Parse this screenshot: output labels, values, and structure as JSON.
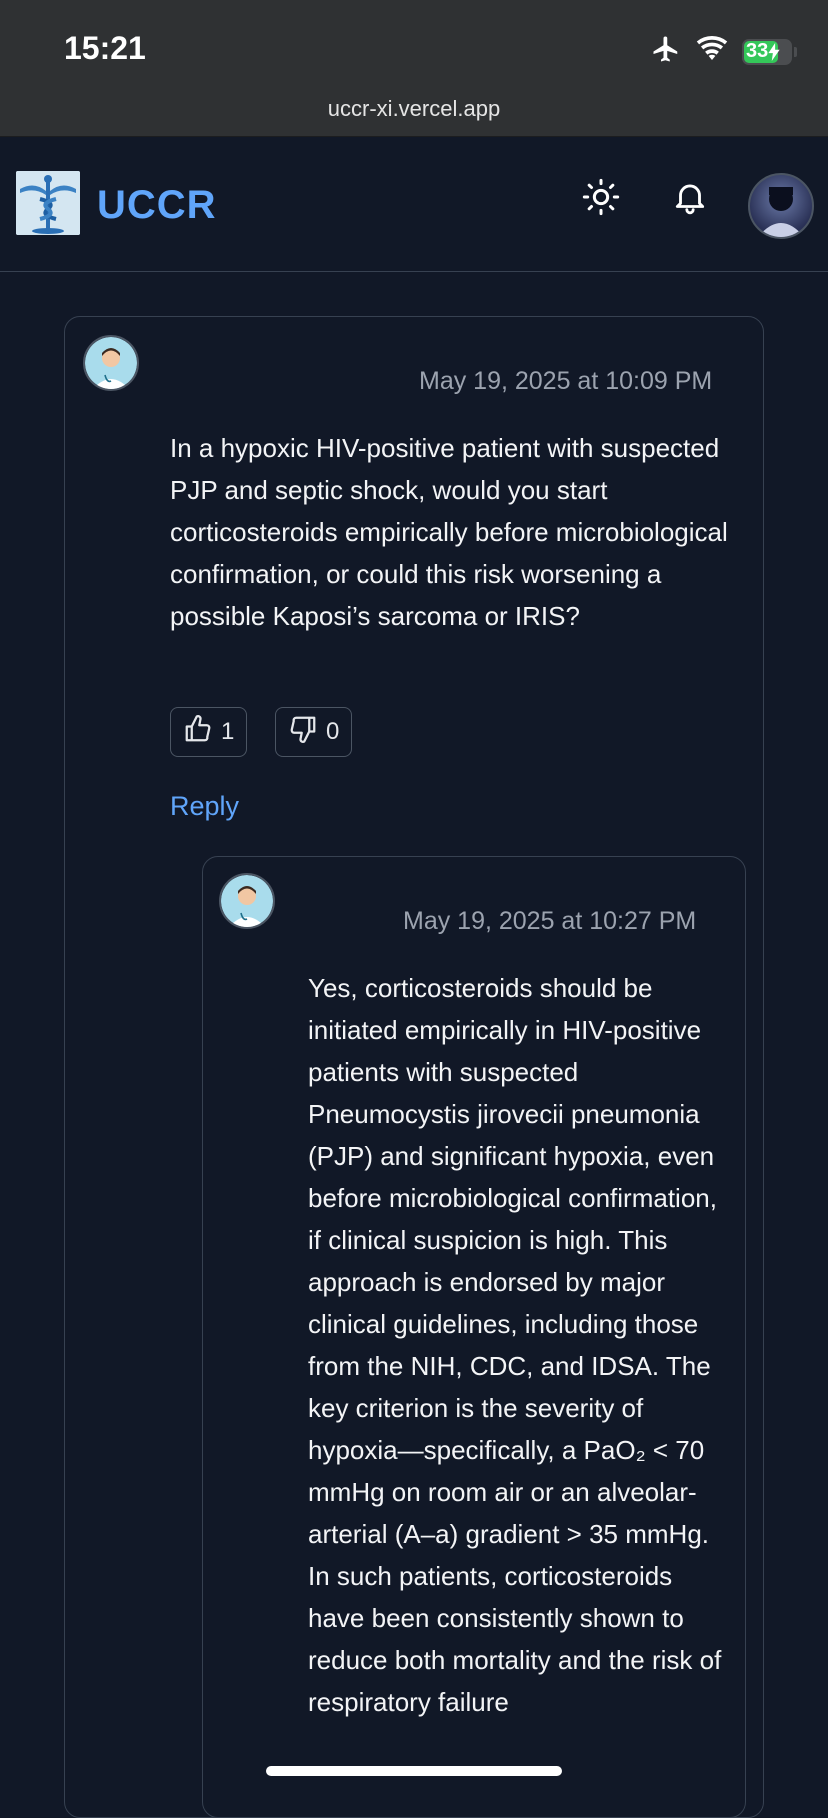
{
  "status_bar": {
    "time": "15:21",
    "battery": "33",
    "url": "uccr-xi.vercel.app",
    "icons": [
      "airplane-icon",
      "wifi-icon",
      "battery-charging-icon"
    ]
  },
  "header": {
    "brand": "UCCR",
    "icons": [
      "caduceus-logo",
      "sun-icon",
      "bell-icon",
      "user-avatar"
    ]
  },
  "colors": {
    "background": "#111827",
    "accent": "#60a5fa",
    "border": "#374151",
    "muted": "#9ca3af"
  },
  "comment": {
    "timestamp": "May 19, 2025 at 10:09 PM",
    "text": "In a hypoxic HIV-positive patient with suspected PJP and septic shock, would you start corticosteroids empirically before microbiological confirmation, or could this risk worsening a possible Kaposi’s sarcoma or IRIS?",
    "upvotes": "1",
    "downvotes": "0",
    "reply_label": "Reply",
    "reply": {
      "timestamp": "May 19, 2025 at 10:27 PM",
      "text_before_sub": "Yes, corticosteroids should be initiated empirically in HIV-positive patients with suspected Pneumocystis jirovecii pneumonia (PJP) and significant hypoxia, even before microbiological confirmation, if clinical suspicion is high. This approach is endorsed by major clinical guidelines, including those from the NIH, CDC, and IDSA. The key criterion is the severity of hypoxia—specifically, a PaO",
      "subscript": "₂",
      "text_after_sub": " < 70 mmHg on room air or an alveolar-arterial (A–a) gradient > 35 mmHg. In such patients, corticosteroids have been consistently shown to reduce both mortality and the risk of respiratory failure"
    }
  }
}
